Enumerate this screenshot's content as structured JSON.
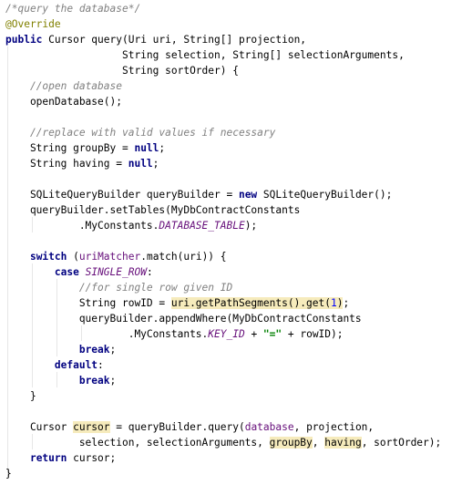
{
  "editor": {
    "language": "java",
    "lines": [
      [
        {
          "t": "/*query the database*/",
          "c": "comment"
        }
      ],
      [
        {
          "t": "@Override",
          "c": "annotation"
        }
      ],
      [
        {
          "t": "public",
          "c": "keyword"
        },
        {
          "t": " Cursor query(Uri uri, String[] projection,"
        }
      ],
      [
        {
          "t": "                   String selection, String[] selectionArguments,"
        }
      ],
      [
        {
          "t": "                   String sortOrder) {"
        }
      ],
      [
        {
          "t": "    "
        },
        {
          "t": "//open database",
          "c": "comment"
        }
      ],
      [
        {
          "t": "    openDatabase();"
        }
      ],
      [],
      [
        {
          "t": "    "
        },
        {
          "t": "//replace with valid values if necessary",
          "c": "comment"
        }
      ],
      [
        {
          "t": "    String groupBy = "
        },
        {
          "t": "null",
          "c": "keyword"
        },
        {
          "t": ";"
        }
      ],
      [
        {
          "t": "    String having = "
        },
        {
          "t": "null",
          "c": "keyword"
        },
        {
          "t": ";"
        }
      ],
      [],
      [
        {
          "t": "    SQLiteQueryBuilder queryBuilder = "
        },
        {
          "t": "new",
          "c": "keyword"
        },
        {
          "t": " SQLiteQueryBuilder();"
        }
      ],
      [
        {
          "t": "    queryBuilder.setTables(MyDbContractConstants"
        }
      ],
      [
        {
          "t": "            .MyConstants."
        },
        {
          "t": "DATABASE_TABLE",
          "c": "static-field"
        },
        {
          "t": ");"
        }
      ],
      [],
      [
        {
          "t": "    "
        },
        {
          "t": "switch",
          "c": "keyword"
        },
        {
          "t": " ("
        },
        {
          "t": "uriMatcher",
          "c": "field"
        },
        {
          "t": ".match(uri)) {"
        }
      ],
      [
        {
          "t": "        "
        },
        {
          "t": "case",
          "c": "keyword"
        },
        {
          "t": " "
        },
        {
          "t": "SINGLE_ROW",
          "c": "static-field"
        },
        {
          "t": ":"
        }
      ],
      [
        {
          "t": "            "
        },
        {
          "t": "//for single row given ID",
          "c": "comment"
        }
      ],
      [
        {
          "t": "            String rowID = "
        },
        {
          "t": "uri.getPathSegments().get(",
          "c": "highlight"
        },
        {
          "t": "1",
          "c": "number-highlight"
        },
        {
          "t": ")",
          "c": "highlight"
        },
        {
          "t": ";"
        }
      ],
      [
        {
          "t": "            queryBuilder.appendWhere(MyDbContractConstants"
        }
      ],
      [
        {
          "t": "                    .MyConstants."
        },
        {
          "t": "KEY_ID",
          "c": "static-field"
        },
        {
          "t": " + "
        },
        {
          "t": "\"=\"",
          "c": "string"
        },
        {
          "t": " + rowID);"
        }
      ],
      [
        {
          "t": "            "
        },
        {
          "t": "break",
          "c": "keyword"
        },
        {
          "t": ";"
        }
      ],
      [
        {
          "t": "        "
        },
        {
          "t": "default",
          "c": "keyword"
        },
        {
          "t": ":"
        }
      ],
      [
        {
          "t": "            "
        },
        {
          "t": "break",
          "c": "keyword"
        },
        {
          "t": ";"
        }
      ],
      [
        {
          "t": "    }"
        }
      ],
      [],
      [
        {
          "t": "    Cursor "
        },
        {
          "t": "cursor",
          "c": "highlight"
        },
        {
          "t": " = queryBuilder.query("
        },
        {
          "t": "database",
          "c": "field"
        },
        {
          "t": ", projection,"
        }
      ],
      [
        {
          "t": "            selection, selectionArguments, "
        },
        {
          "t": "groupBy",
          "c": "highlight"
        },
        {
          "t": ", "
        },
        {
          "t": "having",
          "c": "highlight"
        },
        {
          "t": ", sortOrder);"
        }
      ],
      [
        {
          "t": "    "
        },
        {
          "t": "return",
          "c": "keyword"
        },
        {
          "t": " cursor;"
        }
      ],
      [
        {
          "t": "}"
        }
      ]
    ]
  }
}
